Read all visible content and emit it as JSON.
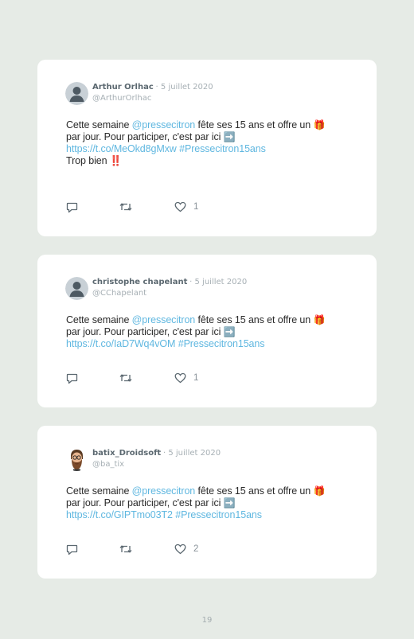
{
  "tweets": [
    {
      "author": "Arthur Orlhac",
      "date": "· 5 juillet 2020",
      "handle": "@ArthurOrlhac",
      "avatar": "default-avatar",
      "text_prefix": "Cette semaine ",
      "mention": "@pressecitron",
      "text_mid": " fête ses 15 ans et offre un ",
      "gift_emoji": "🎁",
      "text_line2": "par jour. Pour participer, c'est par ici ",
      "arrow_emoji": "➡️",
      "link": "https://t.co/MeOkd8gMxw",
      "hashtag": "#Pressecitron15ans",
      "extra_text": "Trop bien ‼️",
      "likes": "1"
    },
    {
      "author": "christophe chapelant",
      "date": "· 5 juillet 2020",
      "handle": "@CChapelant",
      "avatar": "default-avatar",
      "text_prefix": "Cette semaine ",
      "mention": "@pressecitron",
      "text_mid": " fête ses 15 ans et offre un ",
      "gift_emoji": "🎁",
      "text_line2": "par jour. Pour participer, c'est par ici ",
      "arrow_emoji": "➡️",
      "link": "https://t.co/IaD7Wq4vOM",
      "hashtag": "#Pressecitron15ans",
      "likes": "1"
    },
    {
      "author": "batix_Droidsoft",
      "date": "· 5 juillet 2020",
      "handle": "@ba_tix",
      "avatar": "bearded-man-avatar",
      "text_prefix": "Cette semaine ",
      "mention": "@pressecitron",
      "text_mid": " fête ses 15 ans et offre un ",
      "gift_emoji": "🎁",
      "text_line2": "par jour. Pour participer, c'est par ici ",
      "arrow_emoji": "➡️",
      "link": "https://t.co/GIPTmo03T2",
      "hashtag": "#Pressecitron15ans",
      "likes": "2"
    }
  ],
  "icons": {
    "reply": "reply-icon",
    "retweet": "retweet-icon",
    "like": "heart-icon"
  },
  "colors": {
    "background": "#e6ebe6",
    "card": "#ffffff",
    "link": "#5fb7e0",
    "author": "#5b6870",
    "muted": "#a6afb4"
  },
  "page_number": "19"
}
